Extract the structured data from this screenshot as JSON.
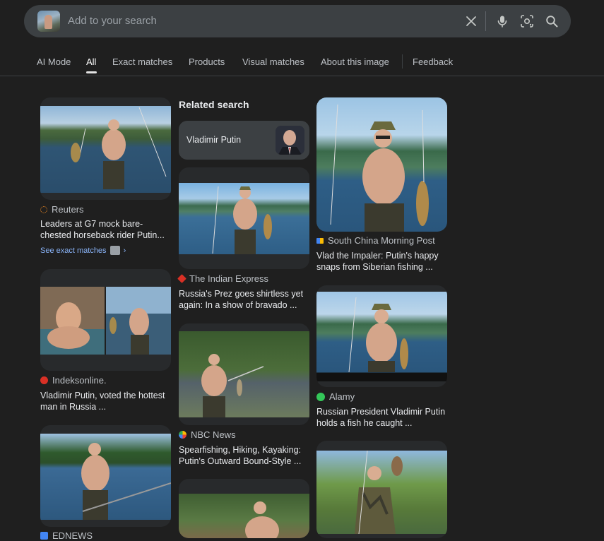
{
  "search": {
    "placeholder": "Add to your search"
  },
  "tabs": [
    {
      "label": "AI Mode"
    },
    {
      "label": "All",
      "active": true
    },
    {
      "label": "Exact matches"
    },
    {
      "label": "Products"
    },
    {
      "label": "Visual matches"
    },
    {
      "label": "About this image"
    },
    {
      "label": "Feedback"
    }
  ],
  "related": {
    "heading": "Related search",
    "chip_label": "Vladimir Putin"
  },
  "results": {
    "reuters": {
      "source": "Reuters",
      "title": "Leaders at G7 mock bare-chested horseback rider Putin...",
      "exact": "See exact matches"
    },
    "indeks": {
      "source": "Indeksonline.",
      "title": "Vladimir Putin, voted the hottest man in Russia ..."
    },
    "ednews": {
      "source": "EDNEWS"
    },
    "indian": {
      "source": "The Indian Express",
      "title": "Russia's Prez goes shirtless yet again: In a show of bravado ..."
    },
    "nbc": {
      "source": "NBC News",
      "title": "Spearfishing, Hiking, Kayaking: Putin's Outward Bound-Style ..."
    },
    "scmp": {
      "source": "South China Morning Post",
      "title": "Vlad the Impaler: Putin's happy snaps from Siberian fishing ..."
    },
    "alamy": {
      "source": "Alamy",
      "title": "Russian President Vladimir Putin holds a fish he caught ..."
    }
  },
  "colors": {
    "background": "#1f1f1f",
    "search_bg": "#3c4043",
    "card_bg": "#282a2c",
    "link": "#8ab4f8"
  }
}
